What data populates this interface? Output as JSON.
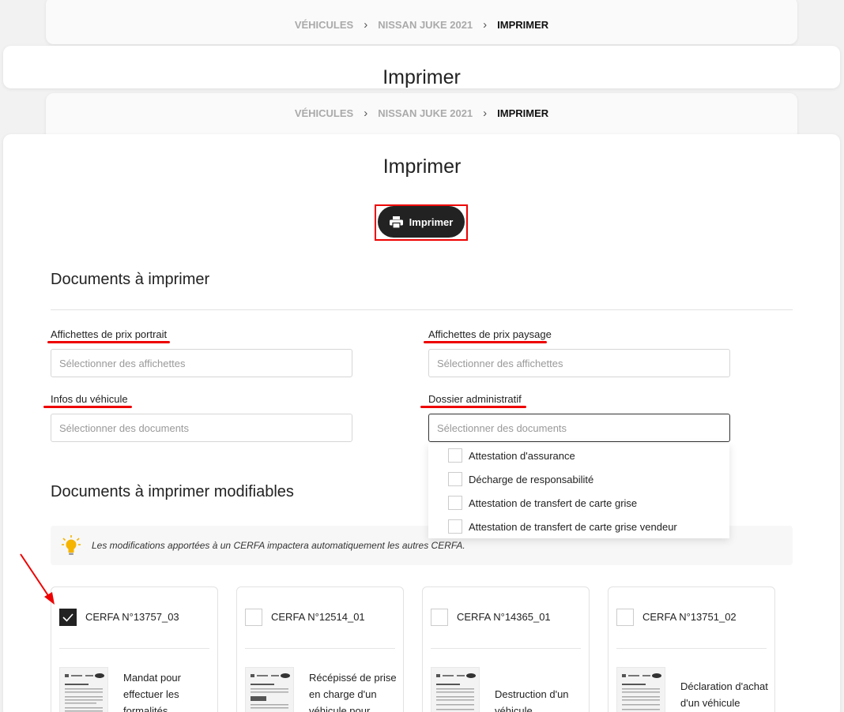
{
  "breadcrumb": {
    "vehicles": "VÉHICULES",
    "vehicle": "NISSAN JUKE 2021",
    "current": "IMPRIMER"
  },
  "page": {
    "title": "Imprimer"
  },
  "print_button": {
    "label": "Imprimer",
    "icon": "printer-icon"
  },
  "documents": {
    "title": "Documents à imprimer",
    "fields": [
      {
        "label": "Affichettes de prix portrait",
        "placeholder": "Sélectionner des affichettes"
      },
      {
        "label": "Affichettes de prix paysage",
        "placeholder": "Sélectionner des affichettes"
      },
      {
        "label": "Infos du véhicule",
        "placeholder": "Sélectionner des documents"
      },
      {
        "label": "Dossier administratif",
        "placeholder": "Sélectionner des documents"
      }
    ],
    "dropdown_options": [
      "Attestation d'assurance",
      "Décharge de responsabilité",
      "Attestation de transfert de carte grise",
      "Attestation de transfert de carte grise vendeur"
    ]
  },
  "editable": {
    "title": "Documents à imprimer modifiables",
    "info": "Les modifications apportées à un CERFA impactera automatiquement les autres CERFA.",
    "cards": [
      {
        "title": "CERFA N°13757_03",
        "checked": true,
        "desc": [
          "Mandat pour",
          "effectuer les",
          "formalités"
        ]
      },
      {
        "title": "CERFA N°12514_01",
        "checked": false,
        "desc": [
          "Récépissé de prise",
          "en charge d'un",
          "véhicule pour"
        ]
      },
      {
        "title": "CERFA N°14365_01",
        "checked": false,
        "desc": [
          "Destruction d'un",
          "véhicule"
        ]
      },
      {
        "title": "CERFA N°13751_02",
        "checked": false,
        "desc": [
          "Déclaration d'achat",
          "d'un véhicule"
        ]
      }
    ]
  },
  "colors": {
    "annotation": "#e00000",
    "button": "#222222",
    "bulb": "#f5b400"
  }
}
